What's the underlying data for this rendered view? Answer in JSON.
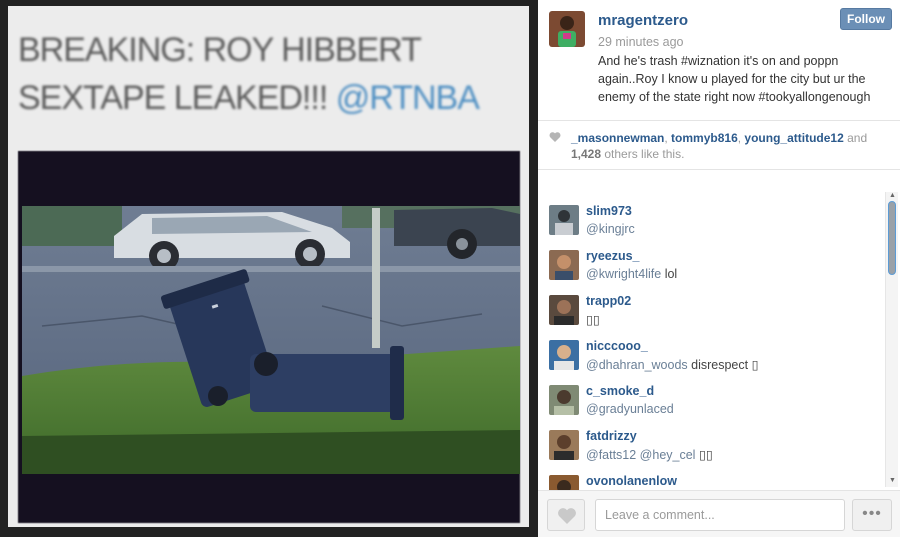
{
  "post_image": {
    "headline_text": "BREAKING: ROY HIBBERT SEXTAPE LEAKED!!!",
    "headline_mention": "@RTNBA"
  },
  "header": {
    "username": "mragentzero",
    "time": "29 minutes ago",
    "caption": "And he's trash #wiznation it's on and poppn again..Roy I know u played for the city but ur the enemy of the state right now #tookyallongenough",
    "follow_label": "Follow"
  },
  "likes": {
    "likers": [
      "_masonnewman",
      "tommyb816",
      "young_attitude12"
    ],
    "and_text": "and",
    "count": "1,428",
    "suffix": "others like this."
  },
  "comments": [
    {
      "user": "slim973",
      "mention": "@kingjrc",
      "text": ""
    },
    {
      "user": "ryeezus_",
      "mention": "@kwright4life",
      "text": " lol"
    },
    {
      "user": "trapp02",
      "mention": "",
      "text": "▯▯"
    },
    {
      "user": "nicccooo_",
      "mention": "@dhahran_woods",
      "text": " disrespect ▯"
    },
    {
      "user": "c_smoke_d",
      "mention": "@gradyunlaced",
      "text": ""
    },
    {
      "user": "fatdrizzy",
      "mention": "@fatts12 @hey_cel",
      "text": " ▯▯"
    },
    {
      "user": "ovonolanenlow",
      "mention": "",
      "text": ""
    }
  ],
  "footer": {
    "comment_placeholder": "Leave a comment...",
    "more_label": "•••"
  },
  "icons": {
    "like": "heart-icon",
    "more": "ellipsis-icon"
  },
  "colors": {
    "link": "#2c5a8c",
    "follow_bg": "#6b8fb6"
  }
}
